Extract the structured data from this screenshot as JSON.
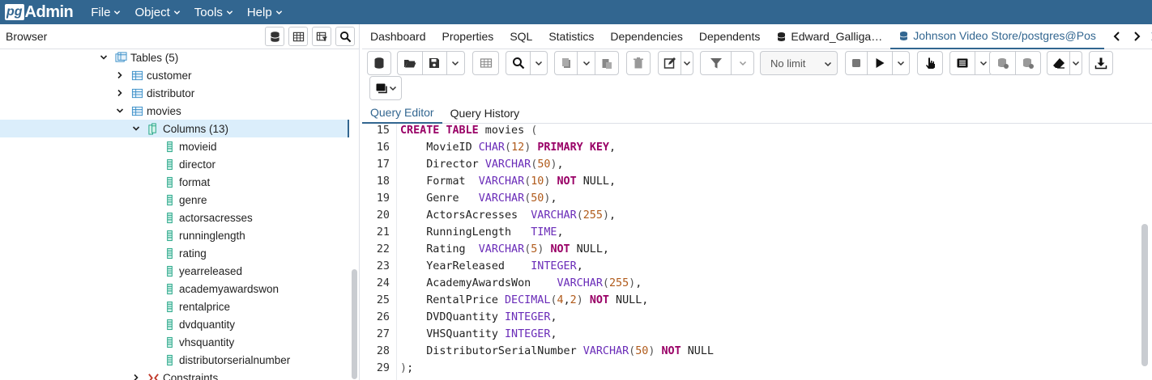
{
  "app": {
    "logo_pg": "pg",
    "logo_admin": "Admin"
  },
  "menu": [
    "File",
    "Object",
    "Tools",
    "Help"
  ],
  "browser": {
    "title": "Browser",
    "tree": [
      {
        "label": "Tables (5)",
        "level": 0,
        "expanded": true,
        "icon": "tables-icon"
      },
      {
        "label": "customer",
        "level": 1,
        "expanded": false,
        "icon": "table-icon"
      },
      {
        "label": "distributor",
        "level": 1,
        "expanded": false,
        "icon": "table-icon"
      },
      {
        "label": "movies",
        "level": 1,
        "expanded": true,
        "icon": "table-icon"
      },
      {
        "label": "Columns (13)",
        "level": 2,
        "expanded": true,
        "icon": "columns-icon",
        "selected": true
      },
      {
        "label": "movieid",
        "level": 3,
        "icon": "column-icon"
      },
      {
        "label": "director",
        "level": 3,
        "icon": "column-icon"
      },
      {
        "label": "format",
        "level": 3,
        "icon": "column-icon"
      },
      {
        "label": "genre",
        "level": 3,
        "icon": "column-icon"
      },
      {
        "label": "actorsacresses",
        "level": 3,
        "icon": "column-icon"
      },
      {
        "label": "runninglength",
        "level": 3,
        "icon": "column-icon"
      },
      {
        "label": "rating",
        "level": 3,
        "icon": "column-icon"
      },
      {
        "label": "yearreleased",
        "level": 3,
        "icon": "column-icon"
      },
      {
        "label": "academyawardswon",
        "level": 3,
        "icon": "column-icon"
      },
      {
        "label": "rentalprice",
        "level": 3,
        "icon": "column-icon"
      },
      {
        "label": "dvdquantity",
        "level": 3,
        "icon": "column-icon"
      },
      {
        "label": "vhsquantity",
        "level": 3,
        "icon": "column-icon"
      },
      {
        "label": "distributorserialnumber",
        "level": 3,
        "icon": "column-icon"
      },
      {
        "label": "Constraints",
        "level": 2,
        "expanded": false,
        "icon": "constraints-icon"
      }
    ]
  },
  "tabs": [
    {
      "label": "Dashboard"
    },
    {
      "label": "Properties"
    },
    {
      "label": "SQL"
    },
    {
      "label": "Statistics"
    },
    {
      "label": "Dependencies"
    },
    {
      "label": "Dependents"
    },
    {
      "label": "Edward_Galliga…",
      "icon": "server-icon"
    },
    {
      "label": "Johnson Video Store/postgres@Pos",
      "icon": "database-icon",
      "active": true
    }
  ],
  "toolbar": {
    "limit_label": "No limit"
  },
  "subtabs": [
    {
      "label": "Query Editor",
      "active": true
    },
    {
      "label": "Query History"
    }
  ],
  "editor": {
    "line_numbers": [
      "15",
      "16",
      "17",
      "18",
      "19",
      "20",
      "21",
      "22",
      "23",
      "24",
      "25",
      "26",
      "27",
      "28",
      "29"
    ],
    "lines": [
      [
        [
          "kw",
          "CREATE"
        ],
        [
          "t",
          " "
        ],
        [
          "kw",
          "TABLE"
        ],
        [
          "t",
          " movies "
        ],
        [
          "punc",
          "("
        ]
      ],
      [
        [
          "t",
          "    MovieID "
        ],
        [
          "ty",
          "CHAR"
        ],
        [
          "punc",
          "("
        ],
        [
          "nm",
          "12"
        ],
        [
          "punc",
          ")"
        ],
        [
          "t",
          " "
        ],
        [
          "kw",
          "PRIMARY"
        ],
        [
          "t",
          " "
        ],
        [
          "kw",
          "KEY"
        ],
        [
          "t",
          ","
        ]
      ],
      [
        [
          "t",
          "    Director "
        ],
        [
          "ty",
          "VARCHAR"
        ],
        [
          "punc",
          "("
        ],
        [
          "nm",
          "50"
        ],
        [
          "punc",
          ")"
        ],
        [
          "t",
          ","
        ]
      ],
      [
        [
          "t",
          "    Format  "
        ],
        [
          "ty",
          "VARCHAR"
        ],
        [
          "punc",
          "("
        ],
        [
          "nm",
          "10"
        ],
        [
          "punc",
          ")"
        ],
        [
          "t",
          " "
        ],
        [
          "kw",
          "NOT"
        ],
        [
          "t",
          " NULL,"
        ]
      ],
      [
        [
          "t",
          "    Genre   "
        ],
        [
          "ty",
          "VARCHAR"
        ],
        [
          "punc",
          "("
        ],
        [
          "nm",
          "50"
        ],
        [
          "punc",
          ")"
        ],
        [
          "t",
          ","
        ]
      ],
      [
        [
          "t",
          "    ActorsAcresses  "
        ],
        [
          "ty",
          "VARCHAR"
        ],
        [
          "punc",
          "("
        ],
        [
          "nm",
          "255"
        ],
        [
          "punc",
          ")"
        ],
        [
          "t",
          ","
        ]
      ],
      [
        [
          "t",
          "    RunningLength   "
        ],
        [
          "ty",
          "TIME"
        ],
        [
          "t",
          ","
        ]
      ],
      [
        [
          "t",
          "    Rating  "
        ],
        [
          "ty",
          "VARCHAR"
        ],
        [
          "punc",
          "("
        ],
        [
          "nm",
          "5"
        ],
        [
          "punc",
          ")"
        ],
        [
          "t",
          " "
        ],
        [
          "kw",
          "NOT"
        ],
        [
          "t",
          " NULL,"
        ]
      ],
      [
        [
          "t",
          "    YearReleased    "
        ],
        [
          "ty",
          "INTEGER"
        ],
        [
          "t",
          ","
        ]
      ],
      [
        [
          "t",
          "    AcademyAwardsWon    "
        ],
        [
          "ty",
          "VARCHAR"
        ],
        [
          "punc",
          "("
        ],
        [
          "nm",
          "255"
        ],
        [
          "punc",
          ")"
        ],
        [
          "t",
          ","
        ]
      ],
      [
        [
          "t",
          "    RentalPrice "
        ],
        [
          "ty",
          "DECIMAL"
        ],
        [
          "punc",
          "("
        ],
        [
          "nm",
          "4"
        ],
        [
          "t",
          ","
        ],
        [
          "nm",
          "2"
        ],
        [
          "punc",
          ")"
        ],
        [
          "t",
          " "
        ],
        [
          "kw",
          "NOT"
        ],
        [
          "t",
          " NULL,"
        ]
      ],
      [
        [
          "t",
          "    DVDQuantity "
        ],
        [
          "ty",
          "INTEGER"
        ],
        [
          "t",
          ","
        ]
      ],
      [
        [
          "t",
          "    VHSQuantity "
        ],
        [
          "ty",
          "INTEGER"
        ],
        [
          "t",
          ","
        ]
      ],
      [
        [
          "t",
          "    DistributorSerialNumber "
        ],
        [
          "ty",
          "VARCHAR"
        ],
        [
          "punc",
          "("
        ],
        [
          "nm",
          "50"
        ],
        [
          "punc",
          ")"
        ],
        [
          "t",
          " "
        ],
        [
          "kw",
          "NOT"
        ],
        [
          "t",
          " NULL"
        ]
      ],
      [
        [
          "punc",
          ")"
        ],
        [
          "t",
          ";"
        ]
      ]
    ]
  },
  "colors": {
    "brand": "#326690",
    "selected_row": "#dbeefb",
    "keyword": "#990066",
    "type": "#6a2cb8",
    "number": "#b05a1a"
  }
}
